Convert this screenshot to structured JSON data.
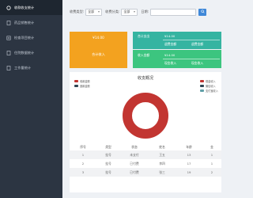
{
  "sidebar": {
    "items": [
      {
        "label": "收款收支统计",
        "active": true,
        "icon": "circle-icon"
      },
      {
        "label": "药品销售统计",
        "active": false,
        "icon": "document-icon"
      },
      {
        "label": "检查项目统计",
        "active": false,
        "icon": "list-icon"
      },
      {
        "label": "住院数据统计",
        "active": false,
        "icon": "document-icon"
      },
      {
        "label": "工作量统计",
        "active": false,
        "icon": "document-icon"
      }
    ]
  },
  "filters": {
    "type_label": "收费类型:",
    "type_value": "全部",
    "pay_label": "收费分类:",
    "pay_value": "全部",
    "date_label": "日期:",
    "date_value": ""
  },
  "summary": {
    "orange": {
      "value": "¥14.00",
      "label": "合计收入"
    },
    "teal": {
      "row1_label": "合计支出",
      "row1_value": "¥14.00",
      "row2_label": "退费金额",
      "row2_value": "退费金额"
    },
    "green": {
      "row1_label": "收入金额",
      "row1_value": "¥14.00",
      "row2_label": "现金收入",
      "row2_value": "现金收入"
    }
  },
  "chart_data": {
    "type": "pie",
    "title": "收支概况",
    "legend_left": [
      {
        "name": "收款金额",
        "color": "#c23531"
      },
      {
        "name": "退款金额",
        "color": "#2f4554"
      }
    ],
    "legend_right": [
      {
        "name": "现金收入",
        "color": "#c23531"
      },
      {
        "name": "微信收入",
        "color": "#2f4554"
      },
      {
        "name": "支付宝收入",
        "color": "#61a0a8"
      }
    ],
    "slices": [
      {
        "name": "现金收入",
        "value": 100,
        "color": "#c23531"
      }
    ]
  },
  "table": {
    "headers": [
      "序号",
      "类型",
      "状态",
      "姓名",
      "年龄",
      "金"
    ],
    "rows": [
      [
        "1",
        "挂号",
        "未支付",
        "王五",
        "13",
        "1"
      ],
      [
        "2",
        "挂号",
        "已付费",
        "李四",
        "17",
        "1"
      ],
      [
        "3",
        "挂号",
        "已付费",
        "张三",
        "19",
        "2"
      ]
    ]
  },
  "colors": {
    "sidebar_bg": "#2c3542",
    "sidebar_active": "#1e2630",
    "orange": "#f3a21f",
    "teal": "#35b4a1",
    "green": "#3cc57f",
    "accent": "#3f88d8",
    "pie_red": "#c23531"
  }
}
